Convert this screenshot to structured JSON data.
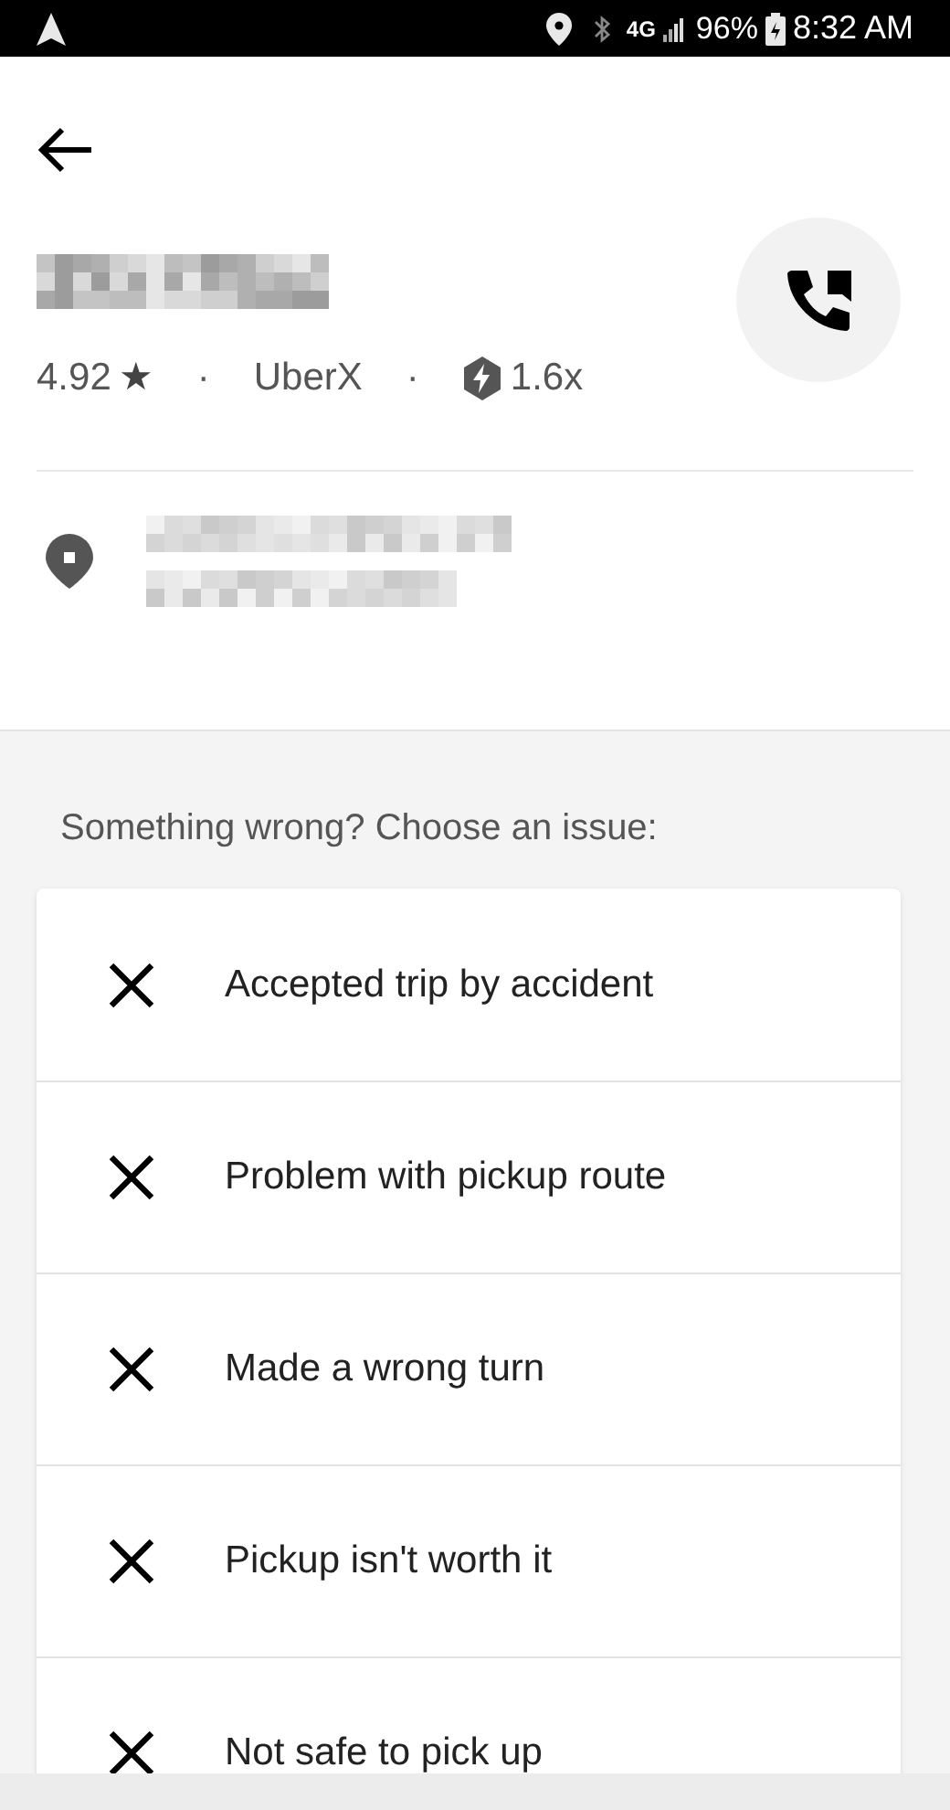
{
  "status_bar": {
    "network": "4G",
    "battery": "96%",
    "time": "8:32 AM"
  },
  "driver": {
    "rating": "4.92",
    "star": "★",
    "separator_1": "·",
    "vehicle": "UberX",
    "separator_2": "·",
    "surge": "1.6x"
  },
  "issues": {
    "heading": "Something wrong? Choose an issue:",
    "items": [
      {
        "label": "Accepted trip by accident"
      },
      {
        "label": "Problem with pickup route"
      },
      {
        "label": "Made a wrong turn"
      },
      {
        "label": "Pickup isn't worth it"
      },
      {
        "label": "Not safe to pick up"
      }
    ]
  }
}
